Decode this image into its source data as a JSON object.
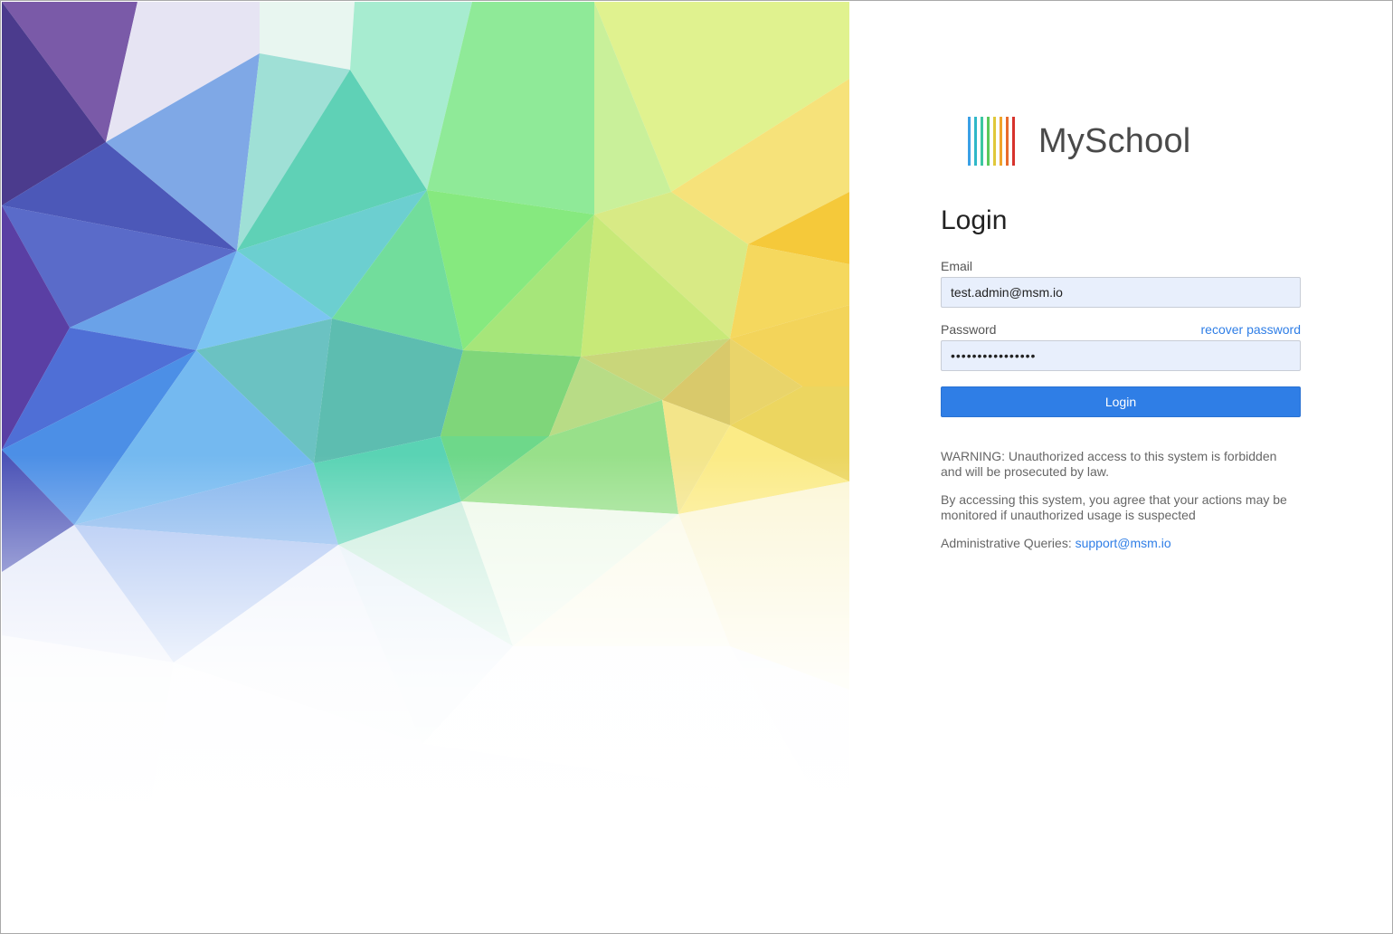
{
  "brand": {
    "name": "MySchool",
    "bar_colors": [
      "#3aa0e6",
      "#2fb8c8",
      "#3cc7a0",
      "#5cc95a",
      "#e0c83a",
      "#f0a32d",
      "#e86a2c",
      "#d7332d"
    ],
    "text_color": "#4a4a4a"
  },
  "login": {
    "title": "Login",
    "email_label": "Email",
    "email_value": "test.admin@msm.io",
    "password_label": "Password",
    "password_value": "••••••••••••••••",
    "recover_label": "recover password",
    "submit_label": "Login",
    "accent": "#2f7ee6"
  },
  "notices": {
    "warning": "WARNING: Unauthorized access to this system is forbidden and will be prosecuted by law.",
    "monitoring": "By accessing this system, you agree that your actions may be monitored if unauthorized usage is suspected",
    "admin_prefix": "Administrative Queries:",
    "admin_email": "support@msm.io"
  }
}
